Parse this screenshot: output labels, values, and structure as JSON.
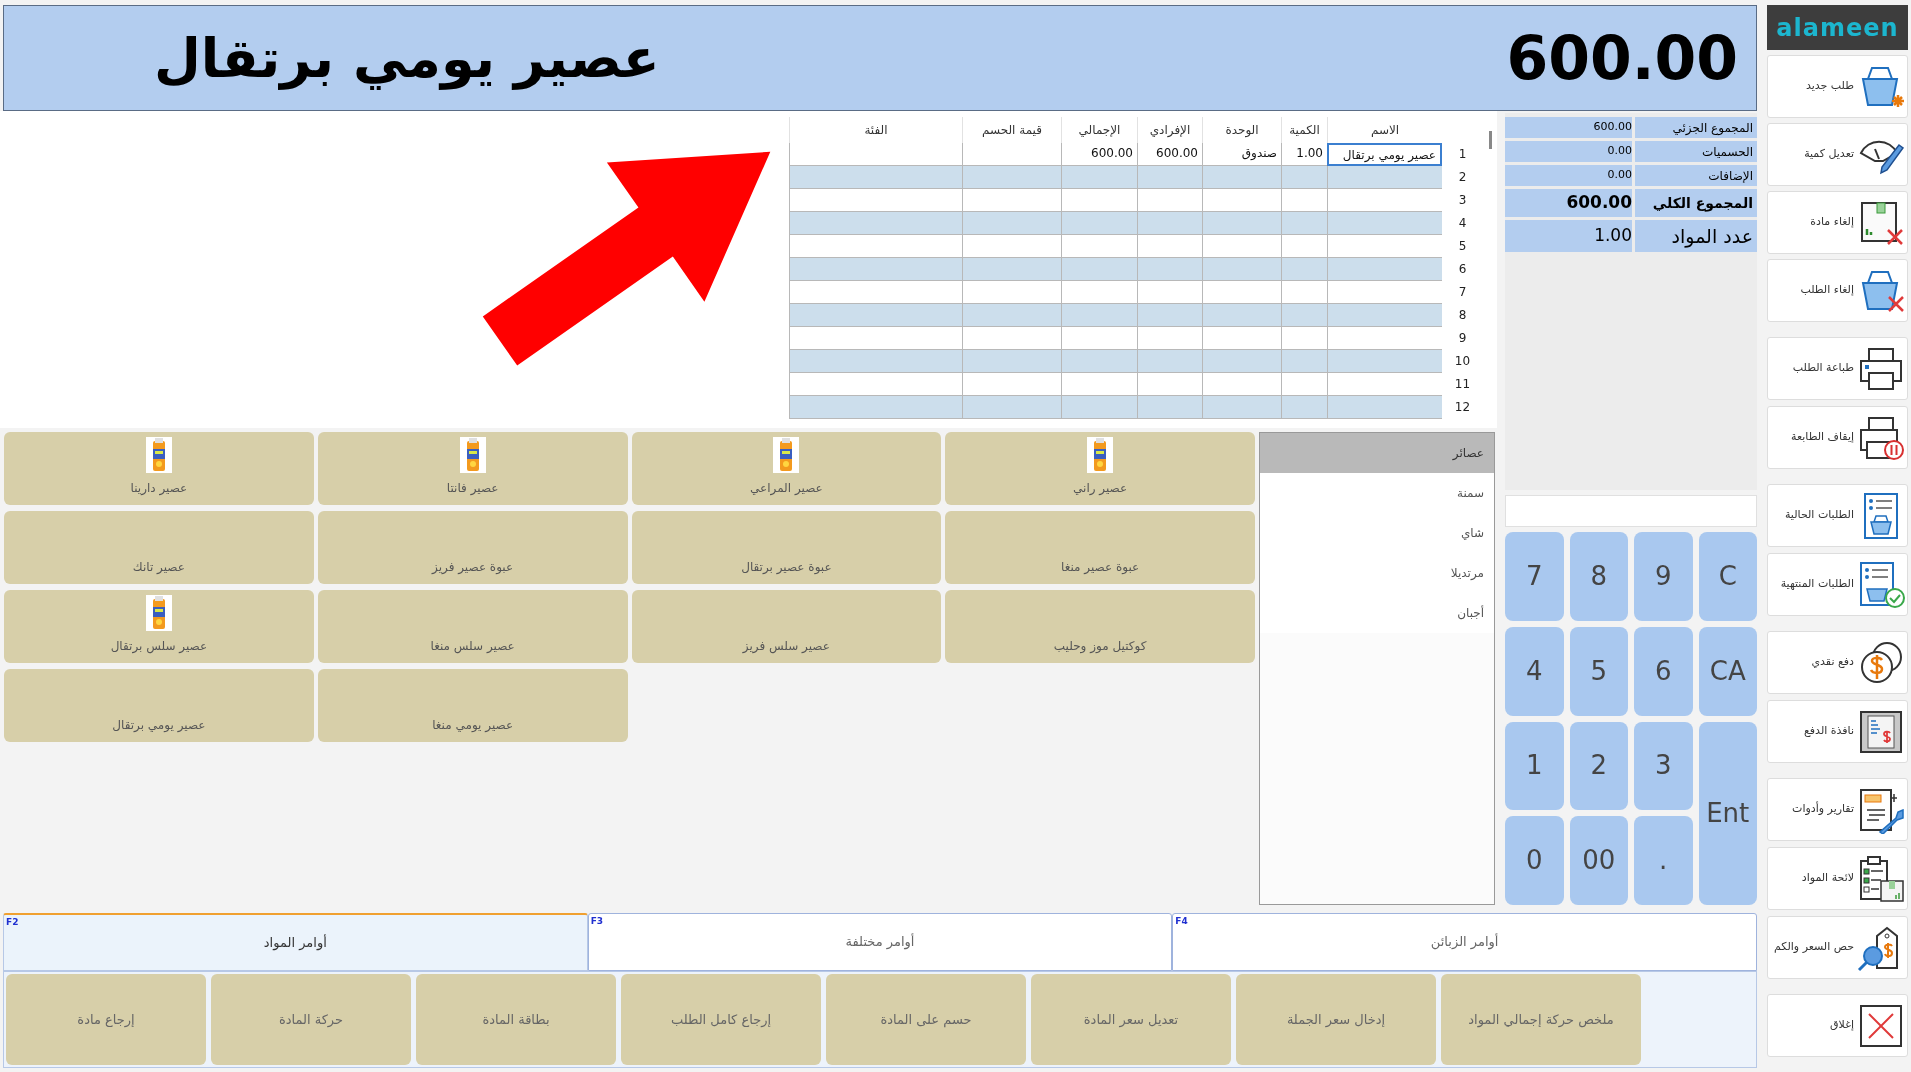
{
  "header": {
    "item_name": "عصير يومي برتقال",
    "total": "600.00"
  },
  "order_table": {
    "columns": [
      "الاسم",
      "الكمية",
      "الوحدة",
      "الإفرادي",
      "الإجمالي",
      "قيمة الحسم",
      "الفئة"
    ],
    "rows": [
      {
        "number": "1",
        "selected": true,
        "cells": [
          "عصير يومي برتقال",
          "1.00",
          "صندوق",
          "600.00",
          "600.00"
        ]
      },
      {
        "number": "2",
        "selected": false
      },
      {
        "number": "3",
        "selected": false
      },
      {
        "number": "4",
        "selected": false
      },
      {
        "number": "5",
        "selected": false
      },
      {
        "number": "6",
        "selected": false
      },
      {
        "number": "7",
        "selected": false
      },
      {
        "number": "8",
        "selected": false
      },
      {
        "number": "9",
        "selected": false
      },
      {
        "number": "10",
        "selected": false
      },
      {
        "number": "11",
        "selected": false
      },
      {
        "number": "12",
        "selected": false
      }
    ]
  },
  "summary": [
    {
      "kind": "line",
      "label": "المجموع الجزئي",
      "value": "600.00"
    },
    {
      "kind": "line",
      "label": "الحسميات",
      "value": "0.00"
    },
    {
      "kind": "line",
      "label": "الإضافات",
      "value": "0.00"
    },
    {
      "kind": "total",
      "label": "المجموع الكلي",
      "value": "600.00"
    },
    {
      "kind": "count",
      "label": "عدد المواد",
      "value": "1.00"
    }
  ],
  "products": [
    {
      "name": "عصير راني",
      "image": true
    },
    {
      "name": "عصير المراعي",
      "image": true
    },
    {
      "name": "عصير فانتا",
      "image": true
    },
    {
      "name": "عصير دارينا",
      "image": true
    },
    {
      "name": "عبوة عصير منغا",
      "image": false
    },
    {
      "name": "عبوة عصير برتقال",
      "image": false
    },
    {
      "name": "عبوة عصير فريز",
      "image": false
    },
    {
      "name": "عصير تانك",
      "image": false
    },
    {
      "name": "كوكتيل موز وحليب",
      "image": false
    },
    {
      "name": "عصير سلس فريز",
      "image": false
    },
    {
      "name": "عصير سلس منغا",
      "image": false
    },
    {
      "name": "عصير سلس برتقال",
      "image": true
    },
    {
      "name": "عصير يومي منغا",
      "image": false
    },
    {
      "name": "عصير يومي برتقال",
      "image": false
    }
  ],
  "categories": [
    {
      "label": "عصائر",
      "selected": true
    },
    {
      "label": "سمنة",
      "selected": false
    },
    {
      "label": "شاي",
      "selected": false
    },
    {
      "label": "مرتديلا",
      "selected": false
    },
    {
      "label": "أجبان",
      "selected": false
    }
  ],
  "keypad": [
    {
      "label": "C",
      "kind": "key"
    },
    {
      "label": "9",
      "kind": "key"
    },
    {
      "label": "8",
      "kind": "key"
    },
    {
      "label": "7",
      "kind": "key"
    },
    {
      "label": "CA",
      "kind": "key"
    },
    {
      "label": "6",
      "kind": "key"
    },
    {
      "label": "5",
      "kind": "key"
    },
    {
      "label": "4",
      "kind": "key"
    },
    {
      "label": "Ent",
      "kind": "enter"
    },
    {
      "label": "3",
      "kind": "key"
    },
    {
      "label": "2",
      "kind": "key"
    },
    {
      "label": "1",
      "kind": "key"
    },
    {
      "label": ".",
      "kind": "key"
    },
    {
      "label": "00",
      "kind": "key"
    },
    {
      "label": "0",
      "kind": "key"
    }
  ],
  "bottom_tabs": [
    {
      "key": "F4",
      "label": "أوامر الزبائن",
      "selected": false
    },
    {
      "key": "F3",
      "label": "أوامر مختلفة",
      "selected": false
    },
    {
      "key": "F2",
      "label": "أوامر المواد",
      "selected": true
    }
  ],
  "item_commands": [
    "ملخص حركة إجمالي المواد",
    "إدخال سعر الجملة",
    "تعديل سعر المادة",
    "حسم على المادة",
    "إرجاع كامل الطلب",
    "بطاقة المادة",
    "حركة المادة",
    "إرجاع مادة"
  ],
  "sidebar": {
    "logo": "alameen",
    "groups": [
      [
        {
          "label": "طلب جديد",
          "kind": "new"
        },
        {
          "label": "تعديل كمية",
          "kind": "scale"
        },
        {
          "label": "إلغاء مادة",
          "kind": "boxcross"
        },
        {
          "label": "إلغاء الطلب",
          "kind": "basketcross"
        }
      ],
      [
        {
          "label": "طباعة الطلب",
          "kind": "printer"
        },
        {
          "label": "إيقاف الطابعة",
          "kind": "pause"
        }
      ],
      [
        {
          "label": "الطلبات الحالية",
          "kind": "list"
        },
        {
          "label": "الطلبات المنتهية",
          "kind": "listcheck"
        }
      ],
      [
        {
          "label": "دفع نقدي",
          "kind": "coins"
        },
        {
          "label": "نافذة الدفع",
          "kind": "receipt"
        }
      ],
      [
        {
          "label": "تقارير وأدوات",
          "kind": "wrench"
        },
        {
          "label": "لائحة المواد",
          "kind": "checklist"
        },
        {
          "label": "حص السعر والكم",
          "kind": "tag"
        }
      ],
      [
        {
          "label": "إغلاق",
          "kind": "close"
        }
      ]
    ]
  }
}
